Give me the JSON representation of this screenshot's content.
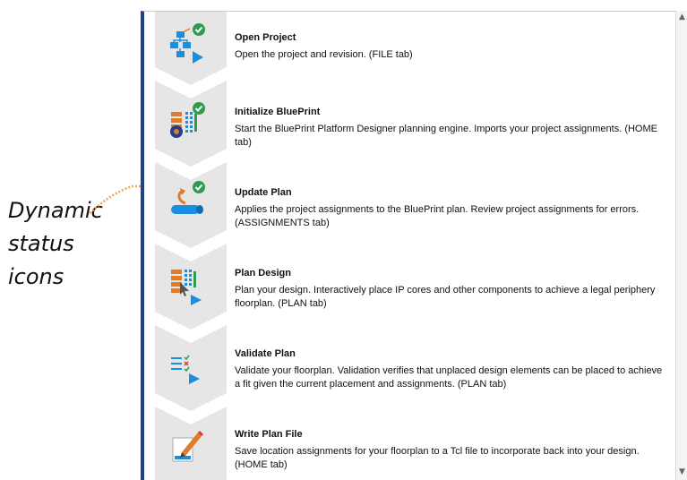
{
  "callout": {
    "lines": [
      "Dynamic",
      "status",
      "icons"
    ]
  },
  "colors": {
    "panel_border": "#1f3f8f",
    "chevron_fill": "#e6e6e6",
    "check_green": "#2e9b4e",
    "accent_blue": "#1a8fe0",
    "accent_orange": "#e07b2a",
    "leader_orange": "#f0a35a"
  },
  "steps": [
    {
      "title": "Open Project",
      "desc": "Open the project and revision. (FILE tab)",
      "icon": "project-tree-icon",
      "status": "complete"
    },
    {
      "title": "Initialize BluePrint",
      "desc": "Start the BluePrint Platform Designer planning engine. Imports your project assignments. (HOME tab)",
      "icon": "grid-gear-icon",
      "status": "complete"
    },
    {
      "title": "Update Plan",
      "desc": "Applies the project assignments to the BluePrint plan. Review project assignments for errors. (ASSIGNMENTS tab)",
      "icon": "update-arrow-icon",
      "status": "complete"
    },
    {
      "title": "Plan Design",
      "desc": "Plan your design. Interactively place IP cores and other components to achieve a legal periphery floorplan. (PLAN tab)",
      "icon": "grid-cursor-icon",
      "status": "pending"
    },
    {
      "title": "Validate Plan",
      "desc": "Validate your floorplan. Validation verifies that unplaced design elements can be placed to achieve a fit given the current placement and assignments. (PLAN tab)",
      "icon": "checklist-icon",
      "status": "pending"
    },
    {
      "title": "Write Plan File",
      "desc": "Save location assignments for your floorplan to a Tcl file to incorporate back into your design. (HOME tab)",
      "icon": "pencil-file-icon",
      "status": "pending"
    }
  ]
}
